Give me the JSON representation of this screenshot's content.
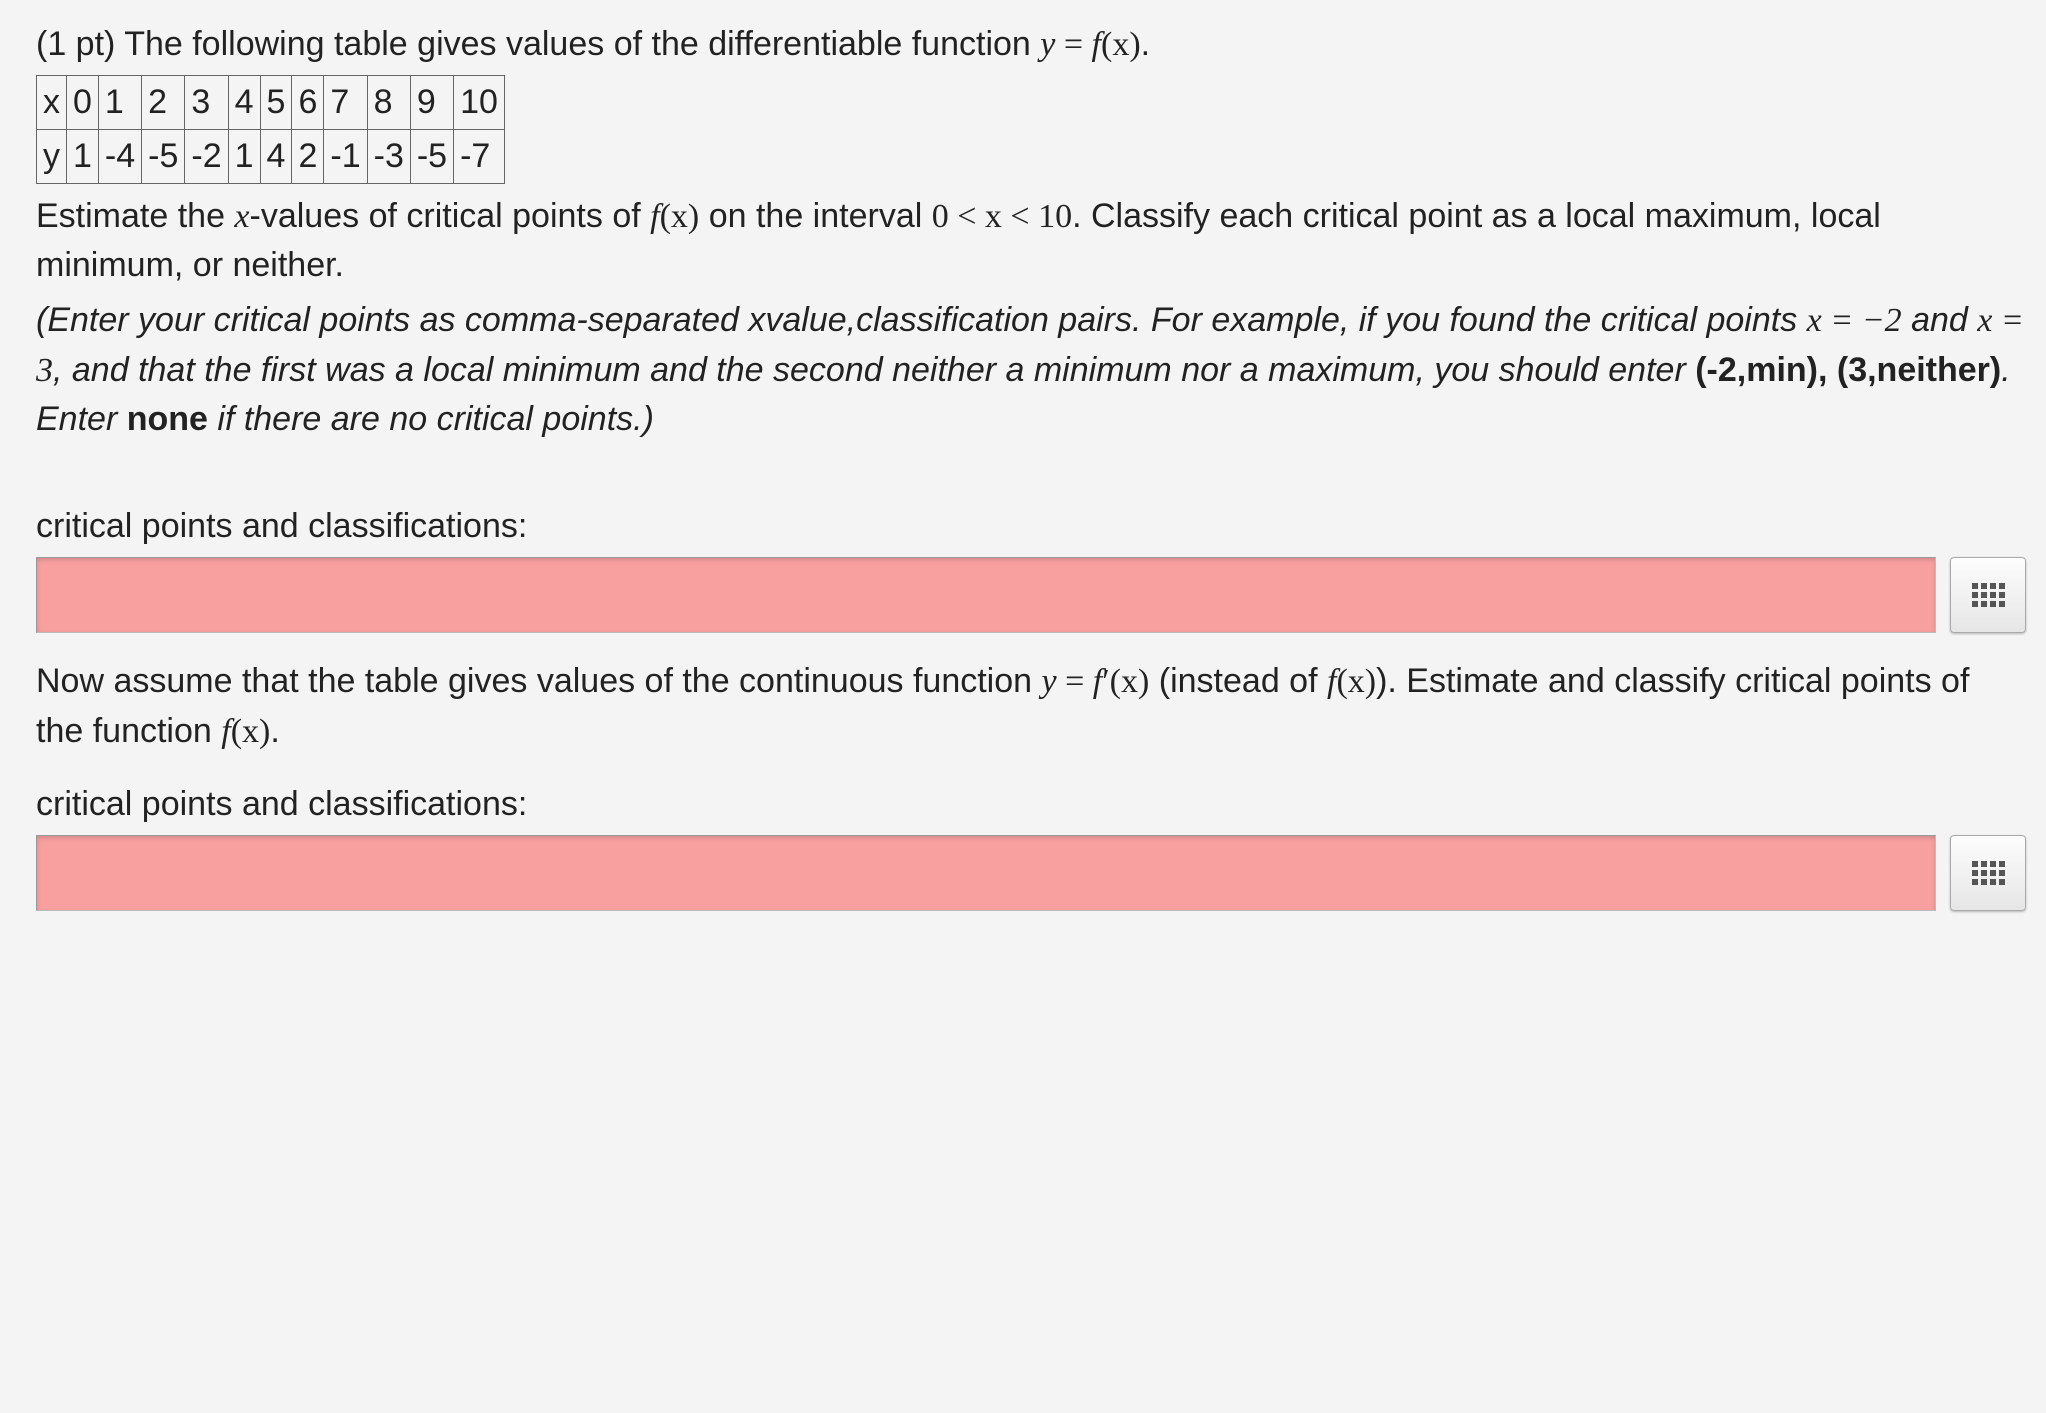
{
  "points_label": "(1 pt)",
  "intro_part1": "The following table gives values of the differentiable function ",
  "intro_eq_lhs": "y",
  "intro_eq_eq": " = ",
  "intro_eq_f": "f",
  "intro_eq_arg": "(x)",
  "intro_period": ".",
  "table": {
    "row_x_label": "x",
    "row_y_label": "y",
    "x": [
      "0",
      "1",
      "2",
      "3",
      "4",
      "5",
      "6",
      "7",
      "8",
      "9",
      "10"
    ],
    "y": [
      "1",
      "-4",
      "-5",
      "-2",
      "1",
      "4",
      "2",
      "-1",
      "-3",
      "-5",
      "-7"
    ]
  },
  "estimate_part1": "Estimate the ",
  "estimate_xvalues": "x",
  "estimate_part2": "-values of critical points of ",
  "estimate_fx_f": "f",
  "estimate_fx_arg": "(x)",
  "estimate_part3": " on the interval ",
  "interval_text": "0 < x < 10",
  "estimate_part4": ". Classify each critical point as a local maximum, local minimum, or neither.",
  "instr_part1": "(Enter your critical points as comma-separated xvalue,classification pairs. For example, if you found the critical points ",
  "instr_x1_lhs": "x",
  "instr_eq": " = ",
  "instr_x1_val": "−",
  "instr_x1_val2": "2",
  "instr_and": " and ",
  "instr_x2_lhs": "x",
  "instr_x2_val": "3",
  "instr_part2": ", and that the first was a local minimum and the second neither a minimum nor a maximum, you should enter ",
  "instr_example": "(-2,min), (3,neither)",
  "instr_part3": ". Enter ",
  "instr_none": "none",
  "instr_part4": " if there are no critical points.)",
  "label_cp": "critical points and classifications:",
  "answer1_value": "",
  "answer1_placeholder": "",
  "part2_text1": "Now assume that the table gives values of the continuous function ",
  "part2_eq_lhs": "y",
  "part2_eq_eq": " = ",
  "part2_eq_f": "f",
  "part2_eq_prime": "′",
  "part2_eq_arg": "(x)",
  "part2_text2": " (instead of ",
  "part2_fx_f": "f",
  "part2_fx_arg": "(x)",
  "part2_text3": "). Estimate and classify critical points of the function ",
  "part2_fx2_f": "f",
  "part2_fx2_arg": "(x)",
  "part2_text4": ".",
  "answer2_value": "",
  "answer2_placeholder": ""
}
